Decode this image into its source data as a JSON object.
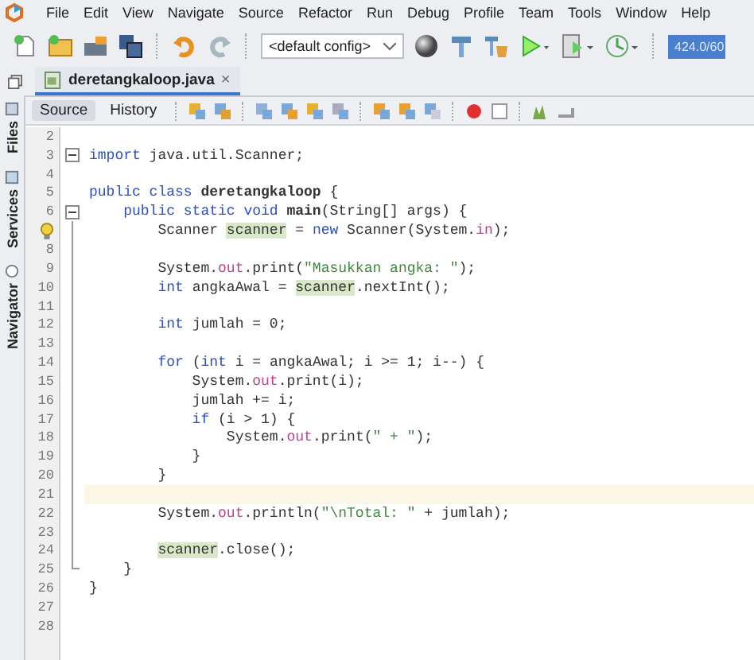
{
  "menu": [
    "File",
    "Edit",
    "View",
    "Navigate",
    "Source",
    "Refactor",
    "Run",
    "Debug",
    "Profile",
    "Team",
    "Tools",
    "Window",
    "Help"
  ],
  "toolbar": {
    "config": "<default config>",
    "memory": "424.0/60"
  },
  "editor_tabs": [
    {
      "label": "deretangkaloop.java",
      "close": "×",
      "selected": true
    }
  ],
  "view_tabs": [
    {
      "label": "Source",
      "selected": true
    },
    {
      "label": "History",
      "selected": false
    }
  ],
  "side_tabs": [
    {
      "label": "Files"
    },
    {
      "label": "Services"
    },
    {
      "label": "Navigator"
    }
  ],
  "lines": [
    {
      "number": "2",
      "current": false
    },
    {
      "number": "3",
      "fold_toggle": true,
      "current": false,
      "tokens": [
        {
          "t": "import",
          "kind": "keyword"
        },
        {
          "t": " java.util.Scanner;",
          "kind": "plain"
        }
      ]
    },
    {
      "number": "4",
      "current": false
    },
    {
      "number": "5",
      "current": false,
      "tokens": [
        {
          "t": "public class ",
          "kind": "keyword"
        },
        {
          "t": "deretangkaloop",
          "kind": "bold"
        },
        {
          "t": " {",
          "kind": "plain"
        }
      ]
    },
    {
      "number": "6",
      "fold_toggle": true,
      "current": false,
      "tokens": [
        {
          "t": "    public static void ",
          "kind": "keyword"
        },
        {
          "t": "main",
          "kind": "bold"
        },
        {
          "t": "(String[] args) {",
          "kind": "plain"
        }
      ]
    },
    {
      "hint": true,
      "current": false,
      "tokens": [
        {
          "t": "        Scanner ",
          "kind": "plain"
        },
        {
          "t": "scanner",
          "kind": "highlight"
        },
        {
          "t": " = ",
          "kind": "plain"
        },
        {
          "t": "new",
          "kind": "keyword"
        },
        {
          "t": " Scanner(System.",
          "kind": "plain"
        },
        {
          "t": "in",
          "kind": "field"
        },
        {
          "t": ");",
          "kind": "plain"
        }
      ]
    },
    {
      "number": "8",
      "current": false
    },
    {
      "number": "9",
      "current": false,
      "tokens": [
        {
          "t": "        System.",
          "kind": "plain"
        },
        {
          "t": "out",
          "kind": "field"
        },
        {
          "t": ".print(",
          "kind": "plain"
        },
        {
          "t": "\"Masukkan angka: \"",
          "kind": "string"
        },
        {
          "t": ");",
          "kind": "plain"
        }
      ]
    },
    {
      "number": "10",
      "current": false,
      "tokens": [
        {
          "t": "        int",
          "kind": "keyword"
        },
        {
          "t": " angkaAwal = ",
          "kind": "plain"
        },
        {
          "t": "scanner",
          "kind": "highlight"
        },
        {
          "t": ".nextInt();",
          "kind": "plain"
        }
      ]
    },
    {
      "number": "11",
      "current": false
    },
    {
      "number": "12",
      "current": false,
      "tokens": [
        {
          "t": "        int",
          "kind": "keyword"
        },
        {
          "t": " jumlah = 0;",
          "kind": "plain"
        }
      ]
    },
    {
      "number": "13",
      "current": false
    },
    {
      "number": "14",
      "current": false,
      "tokens": [
        {
          "t": "        for",
          "kind": "keyword"
        },
        {
          "t": " (",
          "kind": "plain"
        },
        {
          "t": "int",
          "kind": "keyword"
        },
        {
          "t": " i = angkaAwal; i >= 1; i--) {",
          "kind": "plain"
        }
      ]
    },
    {
      "number": "15",
      "current": false,
      "tokens": [
        {
          "t": "            System.",
          "kind": "plain"
        },
        {
          "t": "out",
          "kind": "field"
        },
        {
          "t": ".print(i);",
          "kind": "plain"
        }
      ]
    },
    {
      "number": "16",
      "current": false,
      "tokens": [
        {
          "t": "            jumlah += i;",
          "kind": "plain"
        }
      ]
    },
    {
      "number": "17",
      "current": false,
      "tokens": [
        {
          "t": "            if",
          "kind": "keyword"
        },
        {
          "t": " (i > 1) {",
          "kind": "plain"
        }
      ]
    },
    {
      "number": "18",
      "current": false,
      "tokens": [
        {
          "t": "                System.",
          "kind": "plain"
        },
        {
          "t": "out",
          "kind": "field"
        },
        {
          "t": ".print(",
          "kind": "plain"
        },
        {
          "t": "\" + \"",
          "kind": "string"
        },
        {
          "t": ");",
          "kind": "plain"
        }
      ]
    },
    {
      "number": "19",
      "current": false,
      "tokens": [
        {
          "t": "            }",
          "kind": "plain"
        }
      ]
    },
    {
      "number": "20",
      "current": false,
      "tokens": [
        {
          "t": "        }",
          "kind": "plain"
        }
      ]
    },
    {
      "number": "21",
      "current": true
    },
    {
      "number": "22",
      "current": false,
      "tokens": [
        {
          "t": "        System.",
          "kind": "plain"
        },
        {
          "t": "out",
          "kind": "field"
        },
        {
          "t": ".println(",
          "kind": "plain"
        },
        {
          "t": "\"\\nTotal: \"",
          "kind": "string"
        },
        {
          "t": " + jumlah);",
          "kind": "plain"
        }
      ]
    },
    {
      "number": "23",
      "current": false
    },
    {
      "number": "24",
      "current": false,
      "tokens": [
        {
          "t": "        scanner",
          "kind": "highlight"
        },
        {
          "t": ".close();",
          "kind": "plain"
        }
      ]
    },
    {
      "number": "25",
      "fold_end": true,
      "current": false,
      "tokens": [
        {
          "t": "    }",
          "kind": "plain"
        }
      ]
    },
    {
      "number": "26",
      "current": false,
      "tokens": [
        {
          "t": "}",
          "kind": "plain"
        }
      ]
    },
    {
      "number": "27",
      "current": false
    },
    {
      "number": "28",
      "current": false
    }
  ]
}
